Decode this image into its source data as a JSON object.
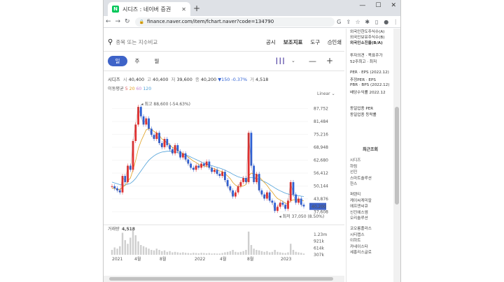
{
  "browser": {
    "tab_title": "시디즈 : 네이버 증권",
    "favicon": "N",
    "url": "finance.naver.com/item/fchart.naver?code=134790",
    "icons": [
      "back-icon",
      "forward-icon",
      "reload-icon",
      "lock-icon",
      "google-icon",
      "share-icon",
      "star-icon",
      "extension-icon",
      "sidepanel-icon",
      "profile-icon",
      "menu-icon"
    ]
  },
  "search": {
    "placeholder": "종목 또는 지수비교"
  },
  "topmenu": {
    "notice": "공시",
    "indicators": "보조지표",
    "tools": "도구",
    "print": "인쇄"
  },
  "periods": [
    "일",
    "주",
    "월"
  ],
  "quote": {
    "name": "시디즈",
    "open_label": "시",
    "open": "40,400",
    "high_label": "고",
    "high": "40,400",
    "low_label": "저",
    "low": "39,600",
    "close_label": "종",
    "close": "40,200",
    "change": "▼150",
    "change_pct": "-0.37%",
    "volume_label": "거",
    "volume": "4,518"
  },
  "moving_avg": {
    "label": "이동평균",
    "p5": "5",
    "p20": "20",
    "p60": "60",
    "p120": "120"
  },
  "scale": "Linear",
  "volume_panel": {
    "label": "거래량",
    "value": "4,518"
  },
  "chart_data": {
    "type": "line",
    "title": "",
    "y_ticks": [
      "87,752",
      "81,484",
      "75,216",
      "68,948",
      "62,680",
      "56,412",
      "50,144",
      "43,876",
      "37,608"
    ],
    "ylim": [
      35000,
      90000
    ],
    "x_ticks": [
      "2021",
      "4월",
      "8월",
      "2022",
      "4월",
      "8월",
      "2023"
    ],
    "max_label": "최고 88,600 (-54.63%)",
    "min_label": "최저 37,050 (8.50%)",
    "current_price": "40,200",
    "volume_ticks": [
      "1.23m",
      "921k",
      "614k",
      "307k"
    ],
    "price_series": [
      50000,
      49000,
      48000,
      47000,
      55000,
      52000,
      60000,
      58000,
      72000,
      80000,
      88600,
      84000,
      80000,
      83000,
      78000,
      75000,
      73000,
      76000,
      71000,
      69000,
      73000,
      70000,
      68000,
      66000,
      70000,
      67000,
      64000,
      66000,
      63000,
      61000,
      59000,
      58000,
      60000,
      59000,
      61000,
      60000,
      62000,
      59000,
      57000,
      58000,
      56000,
      55000,
      57000,
      53000,
      50000,
      48000,
      45000,
      47000,
      50000,
      52000,
      54000,
      52000,
      76000,
      60000,
      52000,
      56000,
      48000,
      46000,
      44000,
      47000,
      43000,
      42000,
      38000,
      40000,
      42000,
      41000,
      39000,
      43000,
      52000,
      46000,
      42000,
      44000,
      41000,
      40200
    ],
    "ma20": [
      49000,
      49000,
      48500,
      48300,
      49600,
      50400,
      52600,
      54000,
      57800,
      62600,
      68200,
      71800,
      74600,
      77400,
      78000,
      77800,
      76600,
      76000,
      74800,
      73000,
      72200,
      71200,
      70200,
      68800,
      68400,
      67600,
      66600,
      66000,
      65200,
      64200,
      63200,
      62200,
      61600,
      60600,
      60200,
      59800,
      59600,
      59300,
      58900,
      58500,
      58000,
      57400,
      57200,
      56200,
      55000,
      53700,
      51800,
      50600,
      49800,
      49800,
      50200,
      50800,
      55000,
      56400,
      56000,
      55600,
      54600,
      53200,
      51800,
      50400,
      48600,
      47200,
      45400,
      44000,
      43400,
      42600,
      41800,
      41600,
      42800,
      43400,
      43400,
      43600,
      43400,
      42800
    ],
    "ma120": [
      52000,
      51600,
      51200,
      50800,
      50600,
      50600,
      51000,
      51400,
      52400,
      53800,
      55600,
      57400,
      59200,
      61000,
      62600,
      63800,
      64800,
      65600,
      66200,
      66600,
      66800,
      67000,
      67000,
      66800,
      66600,
      66400,
      66000,
      65600,
      65200,
      64800,
      64200,
      63600,
      63000,
      62400,
      61800,
      61200,
      60800,
      60400,
      60000,
      59600,
      59200,
      58800,
      58400,
      57800,
      57200,
      56600,
      55800,
      55200,
      54600,
      54200,
      54000,
      53800,
      54200,
      54200,
      54000,
      53800,
      53400,
      52800,
      52200,
      51600,
      50800,
      50000,
      49200,
      48400,
      47800,
      47200,
      46600,
      46200,
      46000,
      45800,
      45600,
      45400,
      45200,
      45000
    ],
    "volume_series": [
      0.2,
      0.3,
      0.25,
      0.35,
      0.9,
      0.6,
      0.45,
      0.7,
      1.0,
      0.8,
      0.55,
      0.4,
      0.35,
      0.3,
      0.25,
      0.2,
      0.18,
      0.25,
      0.2,
      0.15,
      0.18,
      0.12,
      0.15,
      0.1,
      0.12,
      0.1,
      0.08,
      0.1,
      0.08,
      0.07,
      0.06,
      0.08,
      0.07,
      0.06,
      0.08,
      0.07,
      0.06,
      0.07,
      0.05,
      0.06,
      0.05,
      0.05,
      0.07,
      0.1,
      0.12,
      0.15,
      0.2,
      0.12,
      0.1,
      0.12,
      0.15,
      0.2,
      0.95,
      0.4,
      0.25,
      0.2,
      0.18,
      0.15,
      0.12,
      0.15,
      0.1,
      0.12,
      0.2,
      0.12,
      0.1,
      0.08,
      0.07,
      0.1,
      0.45,
      0.2,
      0.12,
      0.1,
      0.08,
      0.05
    ]
  },
  "sidebar": {
    "top_items": [
      "외국인한도주식수(A)",
      "외국인보유주식수(B)",
      "외국인소진율(B/A)"
    ],
    "mid_items": [
      "투자의견 · 목표주가",
      "52주최고 · 최저"
    ],
    "per_items": [
      "PER · EPS (2022.12)",
      "추정PER · EPS",
      "PBR · BPS (2022.12)",
      "배당수익률 2022.12"
    ],
    "industry_items": [
      "동일업종 PER",
      "동일업종 등락률"
    ],
    "recent_title": "최근조회",
    "recent_items": [
      "시디즈",
      "하림",
      "선진",
      "스마트솔루션",
      "한스",
      "퍼텐티",
      "케이씨케미칼",
      "에프앤씨큐",
      "신진에스엠",
      "오리솔루션",
      "코오롱플라스",
      "시티랩스",
      "이하트",
      "카네이스타",
      "세홍리스글로"
    ]
  }
}
